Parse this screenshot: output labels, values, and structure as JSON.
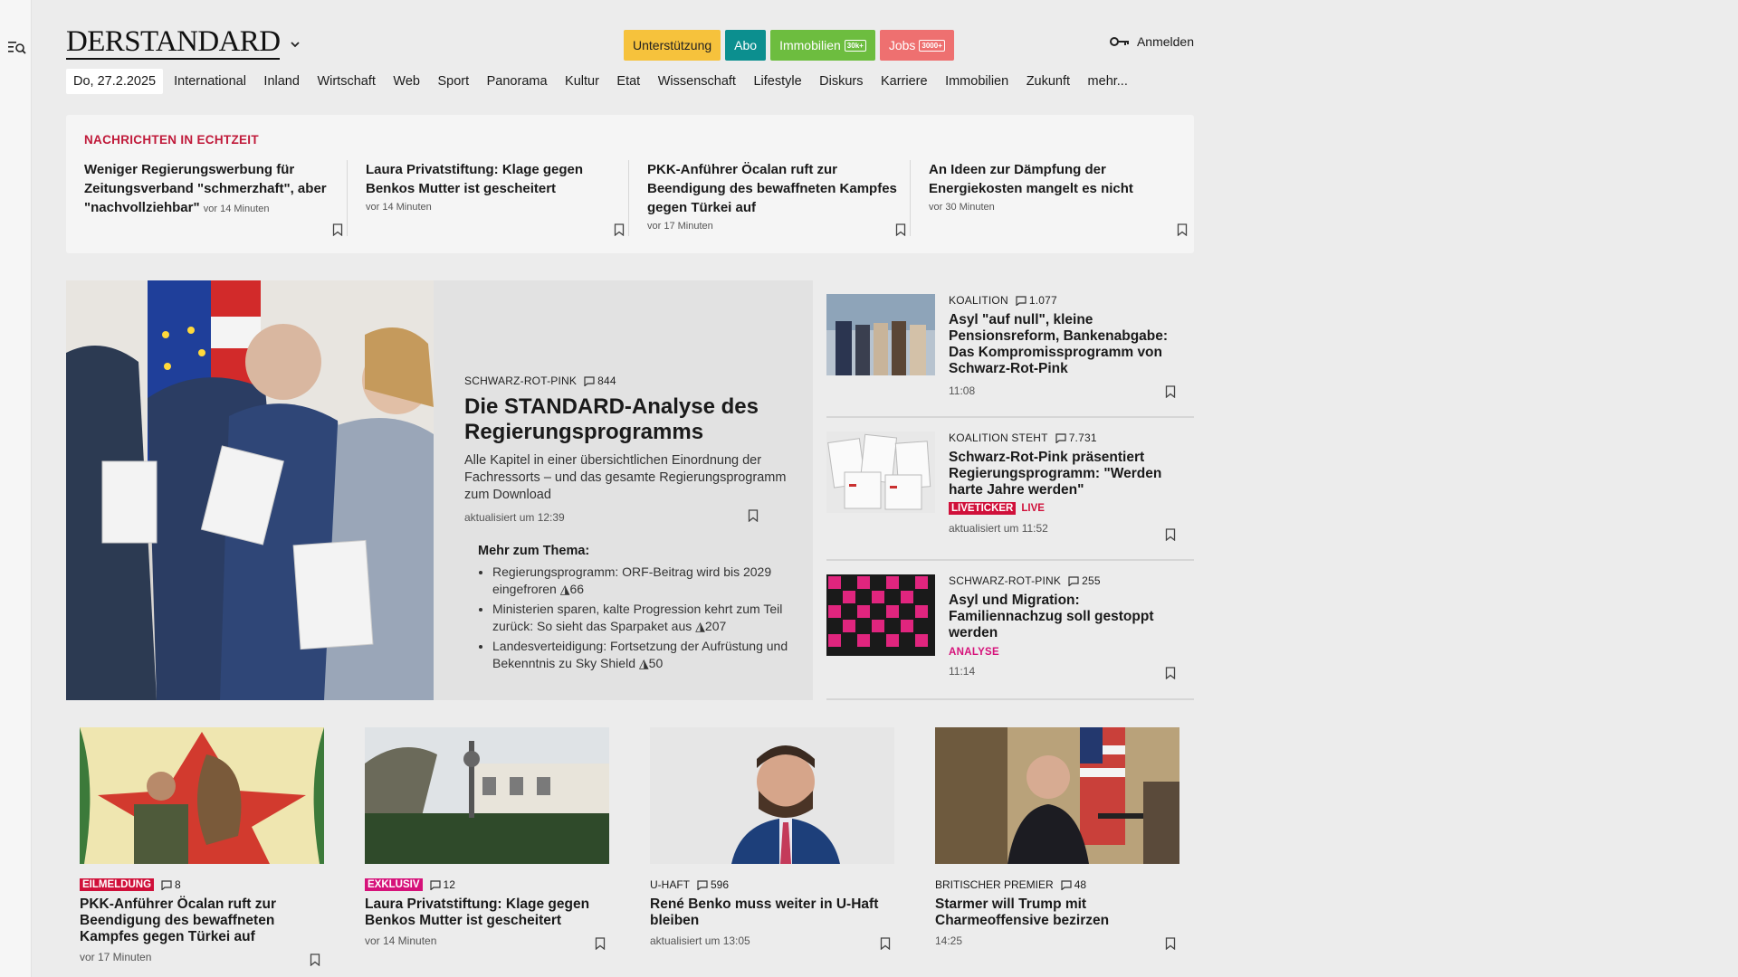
{
  "header": {
    "logo": "DERSTANDARD",
    "buttons": {
      "support": "Unterstützung",
      "abo": "Abo",
      "immo": "Immobilien",
      "immo_tag": "30k+",
      "jobs": "Jobs",
      "jobs_tag": "3000+"
    },
    "login": "Anmelden"
  },
  "nav": {
    "date": "Do, 27.2.2025",
    "items": [
      "International",
      "Inland",
      "Wirtschaft",
      "Web",
      "Sport",
      "Panorama",
      "Kultur",
      "Etat",
      "Wissenschaft",
      "Lifestyle",
      "Diskurs",
      "Karriere",
      "Immobilien",
      "Zukunft",
      "mehr..."
    ]
  },
  "ticker": {
    "heading": "NACHRICHTEN IN ECHTZEIT",
    "items": [
      {
        "title": "Weniger Regierungswerbung für Zeitungsverband \"schmerzhaft\", aber \"nachvollziehbar\"",
        "time": "vor 14 Minuten"
      },
      {
        "title": "Laura Privatstiftung: Klage gegen Benkos Mutter ist gescheitert",
        "time": "vor 14 Minuten"
      },
      {
        "title": "PKK-Anführer Öcalan ruft zur Beendigung des bewaffneten Kampfes gegen Türkei auf",
        "time": "vor 17 Minuten"
      },
      {
        "title": "An Ideen zur Dämpfung der Energiekosten mangelt es nicht",
        "time": "vor 30 Minuten"
      }
    ]
  },
  "hero": {
    "kicker": "SCHWARZ-ROT-PINK",
    "comments": "844",
    "title": "Die STANDARD-Analyse des Regierungsprogramms",
    "subtitle": "Alle Kapitel in einer übersichtlichen Einordnung der Fachressorts – und das gesamte Regierungsprogramm zum Download",
    "updated": "aktualisiert um 12:39",
    "more_heading": "Mehr zum Thema:",
    "more": [
      {
        "text": "Regierungsprogramm: ORF-Beitrag wird bis 2029 eingefroren",
        "comments": "66"
      },
      {
        "text": "Ministerien sparen, kalte Progression kehrt zum Teil zurück: So sieht das Sparpaket aus",
        "comments": "207"
      },
      {
        "text": "Landesverteidigung: Fortsetzung der Aufrüstung und Bekenntnis zu Sky Shield",
        "comments": "50"
      }
    ]
  },
  "side": [
    {
      "kicker": "KOALITION",
      "comments": "1.077",
      "title": "Asyl \"auf null\", kleine Pensionsreform, Bankenabgabe: Das Kompromissprogramm von Schwarz-Rot-Pink",
      "meta": "11:08"
    },
    {
      "kicker": "KOALITION STEHT",
      "comments": "7.731",
      "title": "Schwarz-Rot-Pink präsentiert Regierungsprogramm: \"Werden harte Jahre werden\"",
      "badge": "LIVETICKER",
      "live": "LIVE",
      "meta": "aktualisiert um 11:52"
    },
    {
      "kicker": "SCHWARZ-ROT-PINK",
      "comments": "255",
      "title": "Asyl und Migration: Familiennachzug soll gestoppt werden",
      "label": "ANALYSE",
      "meta": "11:14"
    }
  ],
  "bottom": [
    {
      "badge": "EILMELDUNG",
      "comments": "8",
      "title": "PKK-Anführer Öcalan ruft zur Beendigung des bewaffneten Kampfes gegen Türkei auf",
      "meta": "vor 17 Minuten"
    },
    {
      "badge": "EXKLUSIV",
      "comments": "12",
      "title": "Laura Privatstiftung: Klage gegen Benkos Mutter ist gescheitert",
      "meta": "vor 14 Minuten"
    },
    {
      "kicker": "U-HAFT",
      "comments": "596",
      "title": "René Benko muss weiter in U-Haft bleiben",
      "meta": "aktualisiert um 13:05"
    },
    {
      "kicker": "BRITISCHER PREMIER",
      "comments": "48",
      "title": "Starmer will Trump mit Charmeoffensive bezirzen",
      "meta": "14:25"
    }
  ],
  "colors": {
    "support": "#f6c23c",
    "abo": "#0c8f8f",
    "immo": "#6dbd3f",
    "jobs": "#ee7070",
    "ticker_head": "#c01a3a",
    "live": "#d0103a",
    "analyse": "#d6127a"
  }
}
